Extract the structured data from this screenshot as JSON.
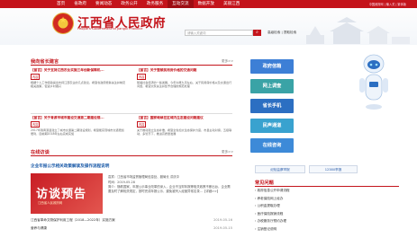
{
  "topnav": {
    "items": [
      "首页",
      "省政府",
      "要闻动态",
      "政务公开",
      "政务服务",
      "互动交流",
      "数据开放",
      "美丽江西"
    ],
    "active_index": 5,
    "right_text": "中国政府网 | 输入关 | 繁体版"
  },
  "header": {
    "title": "江西省人民政府",
    "subtitle": "People's Government of Jiangxi Province",
    "search_placeholder": "请输入关键词",
    "search_links": "高级检索 | 提取检索"
  },
  "mailbox": {
    "title": "我向省长建言",
    "more": "更多>>",
    "items": [
      {
        "q": "【留言】关于支持江西农业实施三年创新保障机...",
        "tag": "内容",
        "body": "根据个人工作经验提出支持江西农业的几点建议，希望省政府能够关注并制定相关政策，促进乡村振兴"
      },
      {
        "q": "【留言】关于整顿民用房价格的交通问题",
        "tag": "内容",
        "body": "随着社会经济的一些发展，今年大概九月左右，关于民用房价格以及交通出行问题，希望大家关注并给予合理的规范处理"
      },
      {
        "q": "【留言】关于青源市城市建设交通第二期建设规...",
        "tag": "内容",
        "body": "2017年我青源县建立了城市交通第二期建设规划，希望能实现城市交通更加便利，目前期2018年左右完成实施"
      },
      {
        "q": "【留言】国家继续在区域内生态建设问题建议",
        "tag": "内容",
        "body": "关于推动建立生态补偿，希望全省加大生态保护力度，市县主动对接，五级联动，多管齐下，推进高质量发展"
      }
    ]
  },
  "interviews": {
    "title": "在线访谈",
    "more": "更多>>",
    "feature_title": "企业年报公示相关政策解读及操作流程说明",
    "poster_text": "访谈预告",
    "poster_sub": "江西省人民政府网",
    "meta": [
      "嘉宾：江西省市场监督管理局信息处、副局长 洪庆中",
      "时间：2019-05-28",
      "简介：随着国家、年报公示事业改革的深入，企业不当财年报等相关政策不断出台，企业需要及时了解相关规定，按时完成年报公示，避免被列入经营异常名录...【详细>>】"
    ],
    "list": [
      {
        "text": "江西省革命文物保护利用工程（2018—2022年）实施方案",
        "date": "2019-05-16"
      },
      {
        "text": "营养与健康",
        "date": "2019-05-15"
      }
    ]
  },
  "quick_buttons": [
    {
      "label": "政府信箱",
      "color": "#3d7fd6"
    },
    {
      "label": "网上调查",
      "color": "#3aa3a6"
    },
    {
      "label": "省长手机",
      "color": "#2c6fc2"
    },
    {
      "label": "民声通道",
      "color": "#39a2cf"
    },
    {
      "label": "在线咨询",
      "color": "#3d8ad8"
    }
  ],
  "bottom_right": {
    "buttons": [
      "纪检监察举报",
      "12380举报"
    ],
    "faq_title": "常见问题",
    "faq": [
      "政府信息公开申请流程",
      "养老保险网上经办",
      "公积金提取办理",
      "医疗保险报销流程",
      "办税服务厅预约办理",
      "注销登记说明"
    ]
  }
}
